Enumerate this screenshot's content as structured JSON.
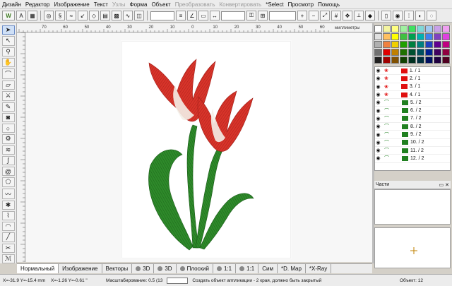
{
  "menu": [
    {
      "label": "Дизайн",
      "disabled": false
    },
    {
      "label": "Редактор",
      "disabled": false
    },
    {
      "label": "Изображение",
      "disabled": false
    },
    {
      "label": "Текст",
      "disabled": false
    },
    {
      "label": "Узлы",
      "disabled": true
    },
    {
      "label": "Форма",
      "disabled": false
    },
    {
      "label": "Объект",
      "disabled": false
    },
    {
      "label": "Преобразовать",
      "disabled": true
    },
    {
      "label": "Конвертировать",
      "disabled": true
    },
    {
      "label": "*Select",
      "disabled": false
    },
    {
      "label": "Просмотр",
      "disabled": false
    },
    {
      "label": "Помощь",
      "disabled": false
    }
  ],
  "ruler": {
    "top_ticks": [
      "70",
      "60",
      "50",
      "40",
      "30",
      "20",
      "10",
      "0",
      "10",
      "20",
      "30",
      "40",
      "50",
      "60"
    ],
    "unit_label": "миллиметры"
  },
  "palette": {
    "colors": [
      [
        "#ffffff",
        "#f4f4a0",
        "#ffff80",
        "#a0f0a0",
        "#40e060",
        "#80d8d8",
        "#a0c8f0",
        "#c8a0e8",
        "#f0a0f0"
      ],
      [
        "#e0e0e0",
        "#ffc060",
        "#ffff00",
        "#40c040",
        "#00a050",
        "#00b0b0",
        "#4080f0",
        "#8040c0",
        "#e040e0"
      ],
      [
        "#b0b0b0",
        "#f08040",
        "#f0d000",
        "#20a000",
        "#008040",
        "#008080",
        "#2040c0",
        "#600090",
        "#c00080"
      ],
      [
        "#707070",
        "#e00000",
        "#c08000",
        "#207000",
        "#005030",
        "#005060",
        "#002090",
        "#400060",
        "#900040"
      ],
      [
        "#202020",
        "#a00000",
        "#805000",
        "#104000",
        "#003020",
        "#003040",
        "#001060",
        "#200040",
        "#500020"
      ]
    ]
  },
  "objects": [
    {
      "label": "1. / 1",
      "color": "#e01010"
    },
    {
      "label": "2. / 1",
      "color": "#e01010"
    },
    {
      "label": "3. / 1",
      "color": "#e01010"
    },
    {
      "label": "4. / 1",
      "color": "#e01010"
    },
    {
      "label": "5. / 2",
      "color": "#208020"
    },
    {
      "label": "6. / 2",
      "color": "#208020"
    },
    {
      "label": "7. / 2",
      "color": "#208020"
    },
    {
      "label": "8. / 2",
      "color": "#208020"
    },
    {
      "label": "9. / 2",
      "color": "#208020"
    },
    {
      "label": "10. / 2",
      "color": "#208020"
    },
    {
      "label": "11. / 2",
      "color": "#208020"
    },
    {
      "label": "12. / 2",
      "color": "#208020"
    }
  ],
  "parts": {
    "title": "Части"
  },
  "tabs": [
    {
      "label": "Нормальный",
      "icon": false,
      "selected": true
    },
    {
      "label": "Изображение",
      "icon": false,
      "selected": false
    },
    {
      "label": "Векторы",
      "icon": false,
      "selected": false
    },
    {
      "label": "3D",
      "icon": true,
      "selected": false
    },
    {
      "label": "3D",
      "icon": true,
      "selected": false
    },
    {
      "label": "Плоский",
      "icon": true,
      "selected": false
    },
    {
      "label": "1:1",
      "icon": true,
      "selected": false
    },
    {
      "label": "1:1",
      "icon": true,
      "selected": false
    },
    {
      "label": "Сим",
      "icon": false,
      "selected": false
    },
    {
      "label": "*D. Map",
      "icon": false,
      "selected": false
    },
    {
      "label": "*X-Ray",
      "icon": false,
      "selected": false
    }
  ],
  "status": {
    "cursor": "X=-31.9  Y=-15.4 mm",
    "delta": "X=-1.26  Y=-0.61 \"",
    "scale_label": "Масштабирование: 0.5 (13",
    "hint": "Создать объект аппликации - 2 края, должно быть закрытый",
    "object_count": "Объект: 12"
  },
  "colors": {
    "petal": "#d8342a",
    "petal_dark": "#a01e18",
    "leaf": "#2e8a2a",
    "leaf_dark": "#1a5a18"
  }
}
